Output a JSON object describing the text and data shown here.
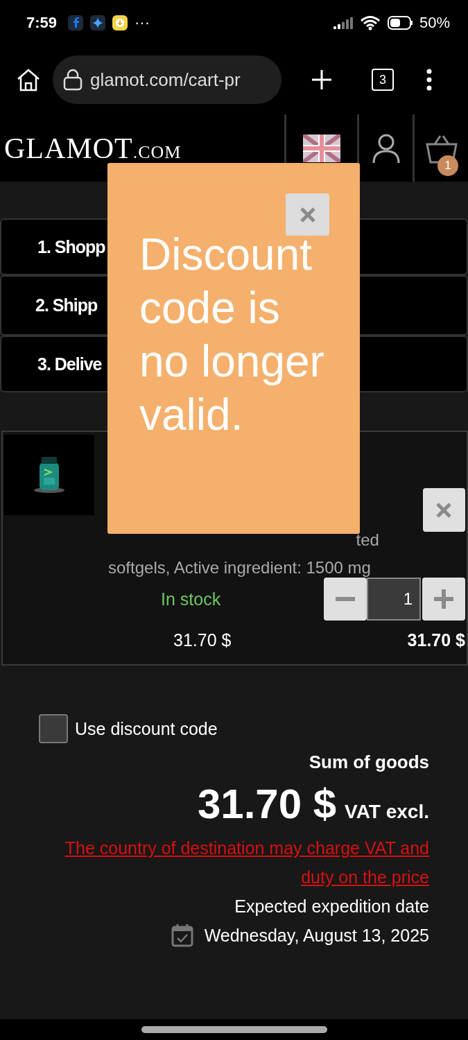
{
  "status_bar": {
    "time": "7:59",
    "more": "···",
    "battery": "50%"
  },
  "browser": {
    "url": "glamot.com/cart-pr",
    "tab_count": "3"
  },
  "header": {
    "logo": "GLAMOT",
    "logo_suffix": ".COM",
    "cart_count": "1"
  },
  "steps": [
    "1. Shopp",
    "2. Shipp",
    "3. Delive"
  ],
  "popup": {
    "message": "Discount code is no longer valid."
  },
  "product": {
    "description_fragment": "ted",
    "description": "softgels, Active ingredient: 1500 mg",
    "stock": "In stock",
    "unit_price": "31.70 $",
    "quantity": "1",
    "total": "31.70 $"
  },
  "summary": {
    "discount_checkbox": {
      "label": "Use discount code",
      "checked": false
    },
    "sum_label": "Sum of goods",
    "sum": "31.70 $",
    "vat_note": "VAT excl.",
    "warning": "The country of destination may charge VAT and duty on the price",
    "expedition_label": "Expected expedition date",
    "expedition_date": "Wednesday, August 13, 2025"
  }
}
